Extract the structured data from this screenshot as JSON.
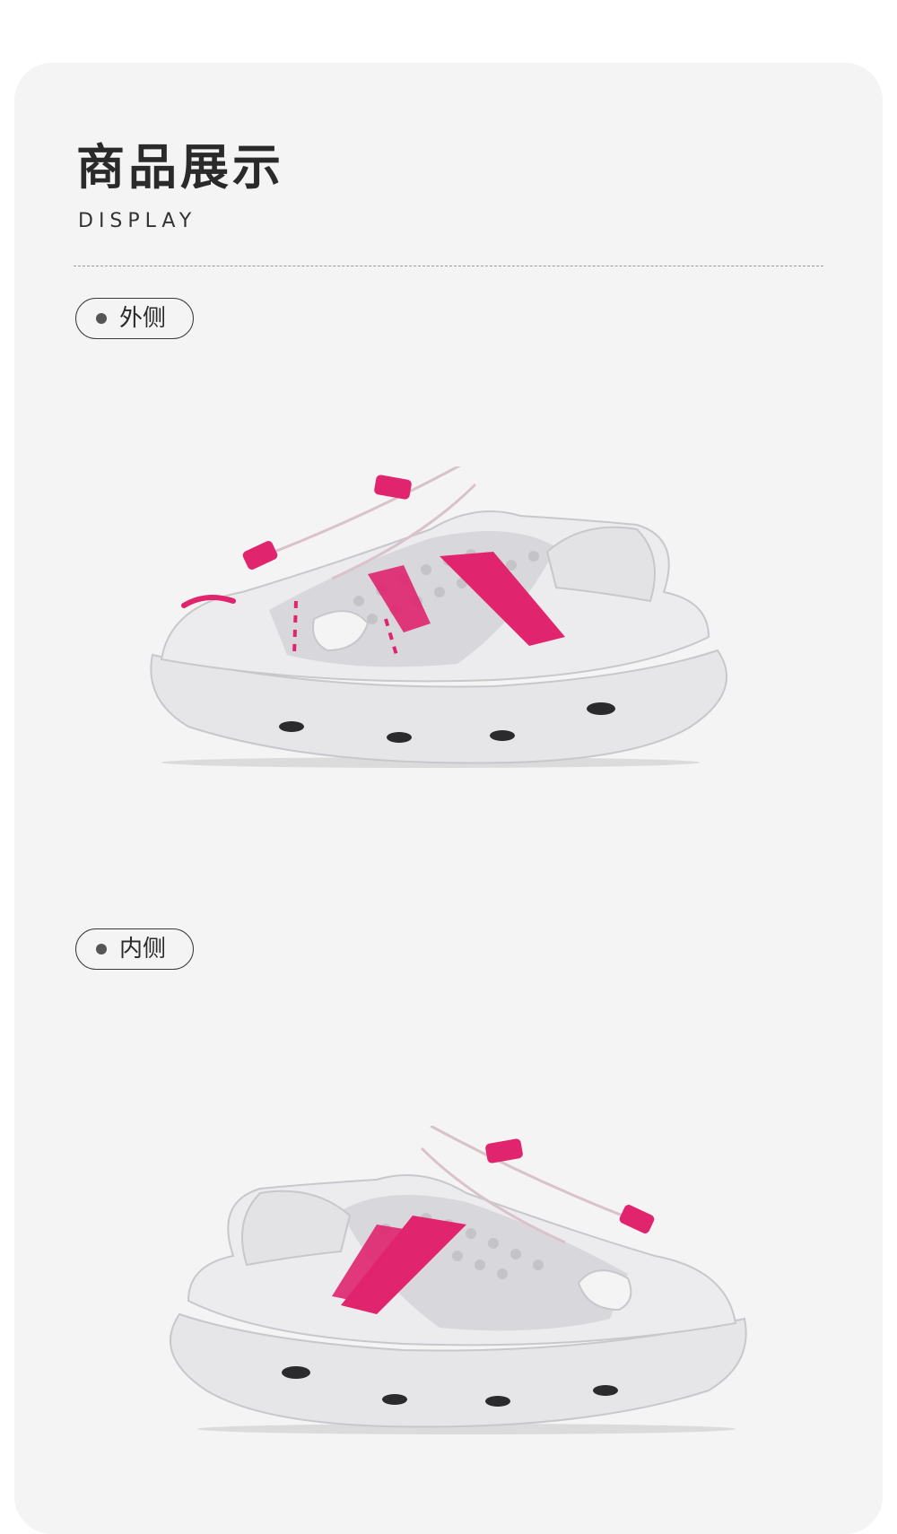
{
  "header": {
    "title_cn": "商品展示",
    "title_en": "DISPLAY"
  },
  "sections": [
    {
      "label": "外侧",
      "image": "shoe-outer-side-image"
    },
    {
      "label": "内侧",
      "image": "shoe-inner-side-image"
    }
  ],
  "colors": {
    "card_bg": "#f4f4f5",
    "accent_pink": "#e0246e",
    "shoe_gray": "#dcdcde",
    "text_dark": "#2a2a2a"
  }
}
